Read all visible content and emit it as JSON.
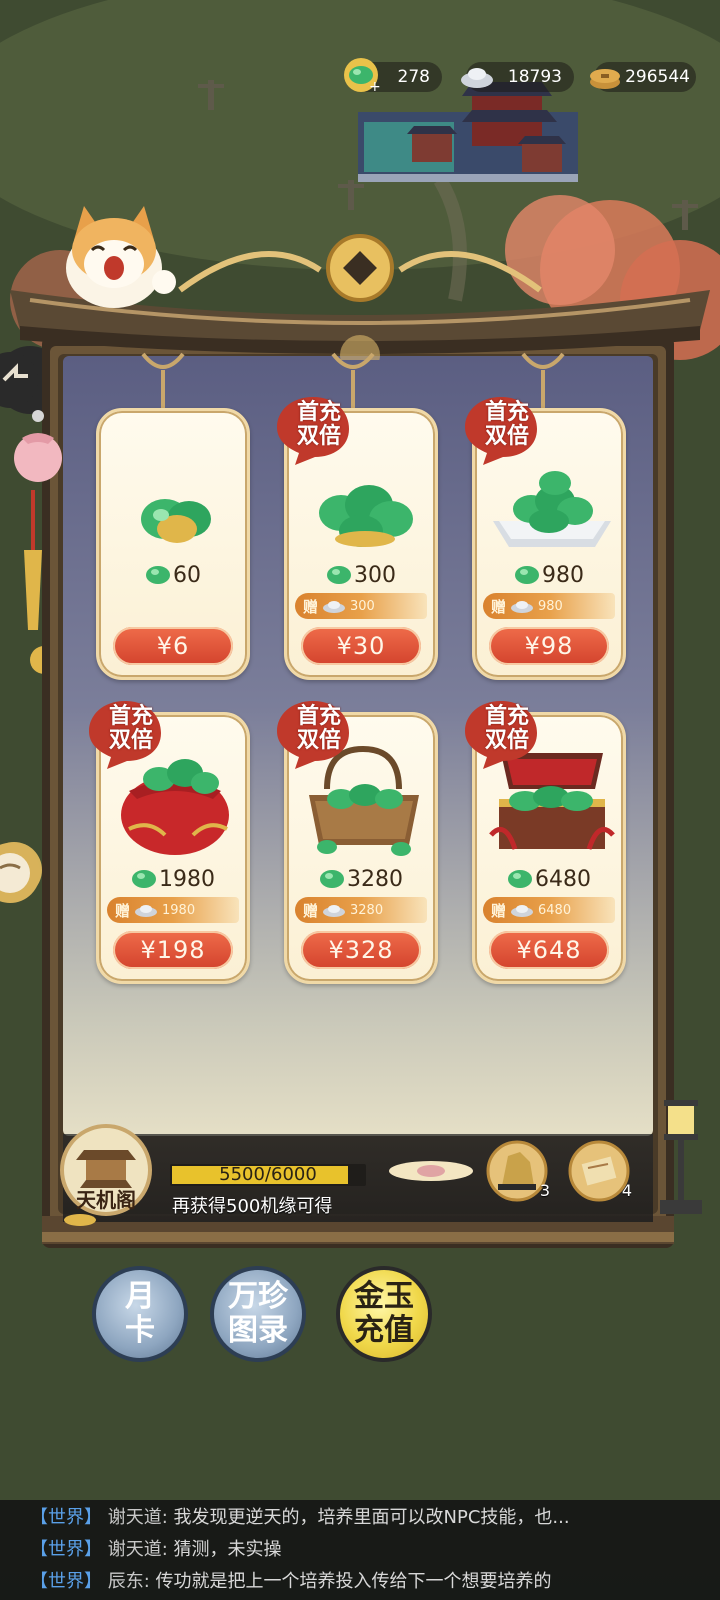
{
  "currencies": {
    "jade": "278",
    "silver": "18793",
    "coins": "296544"
  },
  "badge_text": "首充\n双倍",
  "currency_symbol": "¥",
  "bonus_label": "赠",
  "packs": [
    {
      "amount": "60",
      "bonus": "",
      "price": "¥6",
      "first_double": false
    },
    {
      "amount": "300",
      "bonus": "300",
      "price": "¥30",
      "first_double": true
    },
    {
      "amount": "980",
      "bonus": "980",
      "price": "¥98",
      "first_double": true
    },
    {
      "amount": "1980",
      "bonus": "1980",
      "price": "¥198",
      "first_double": true
    },
    {
      "amount": "3280",
      "bonus": "3280",
      "price": "¥328",
      "first_double": true
    },
    {
      "amount": "6480",
      "bonus": "6480",
      "price": "¥648",
      "first_double": true
    }
  ],
  "progress": {
    "text": "5500/6000",
    "fraction": 0.9167,
    "desc": "再获得500机缘可得"
  },
  "pavilion_label": "天机阁",
  "rewards": [
    {
      "name": "rock-item",
      "count": "3"
    },
    {
      "name": "scroll-item",
      "count": "4"
    }
  ],
  "tabs": [
    {
      "label_line1": "月",
      "label_line2": "卡"
    },
    {
      "label_line1": "万珍",
      "label_line2": "图录"
    },
    {
      "label_line1": "金玉",
      "label_line2": "充值"
    }
  ],
  "chat": [
    {
      "tag": "【世界】",
      "name": "谢天道:",
      "msg": "我发现更逆天的，培养里面可以改NPC技能，也..."
    },
    {
      "tag": "【世界】",
      "name": "谢天道:",
      "msg": "猜测，未实操"
    },
    {
      "tag": "【世界】",
      "name": "辰东:",
      "msg": "传功就是把上一个培养投入传给下一个想要培养的"
    }
  ],
  "colors": {
    "price_button": "#d3432d",
    "progress_fill": "#e8c22c",
    "chat_tag": "#5aa0e8"
  }
}
